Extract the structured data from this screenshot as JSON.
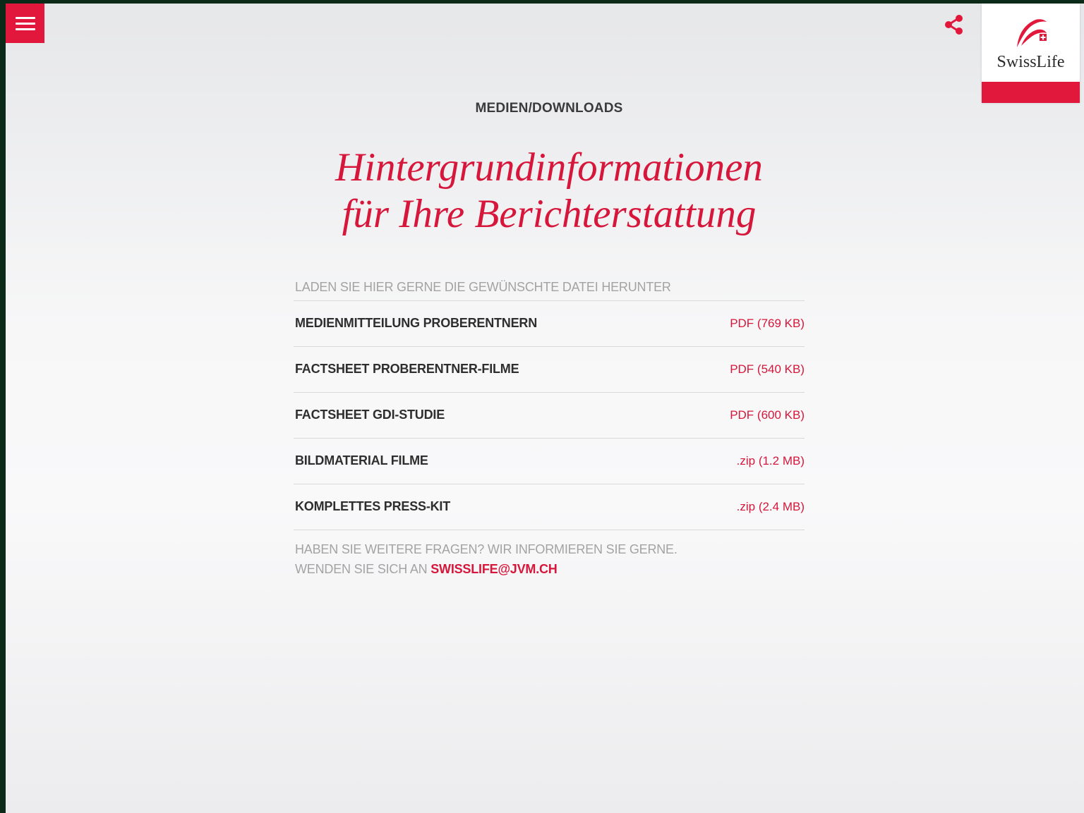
{
  "header": {
    "menu_icon": "hamburger-menu-icon",
    "share_icon": "share-icon",
    "logo_text": "SwissLife"
  },
  "page": {
    "section_label": "MEDIEN/DOWNLOADS",
    "headline_line1": "Hintergrundinformationen",
    "headline_line2": "für Ihre Berichterstattung",
    "intro": "LADEN SIE HIER GERNE DIE GEWÜNSCHTE DATEI HERUNTER"
  },
  "downloads": [
    {
      "title": "MEDIENMITTEILUNG PROBERENTNERN",
      "file": "PDF (769 KB)"
    },
    {
      "title": "FACTSHEET PROBERENTNER-FILME",
      "file": "PDF (540 KB)"
    },
    {
      "title": "FACTSHEET GDI-STUDIE",
      "file": "PDF (600 KB)"
    },
    {
      "title": "BILDMATERIAL FILME",
      "file": ".zip (1.2 MB)"
    },
    {
      "title": "KOMPLETTES PRESS-KIT",
      "file": ".zip (2.4 MB)"
    }
  ],
  "contact": {
    "line1": "HABEN SIE WEITERE FRAGEN? WIR INFORMIEREN SIE GERNE.",
    "line2_prefix": "WENDEN SIE SICH AN ",
    "email": "SWISSLIFE@JVM.CH"
  },
  "colors": {
    "brand_red": "#e1183b",
    "accent_text": "#d6173b",
    "muted_text": "#a3a3a3",
    "dark_text": "#2e2e2e"
  }
}
